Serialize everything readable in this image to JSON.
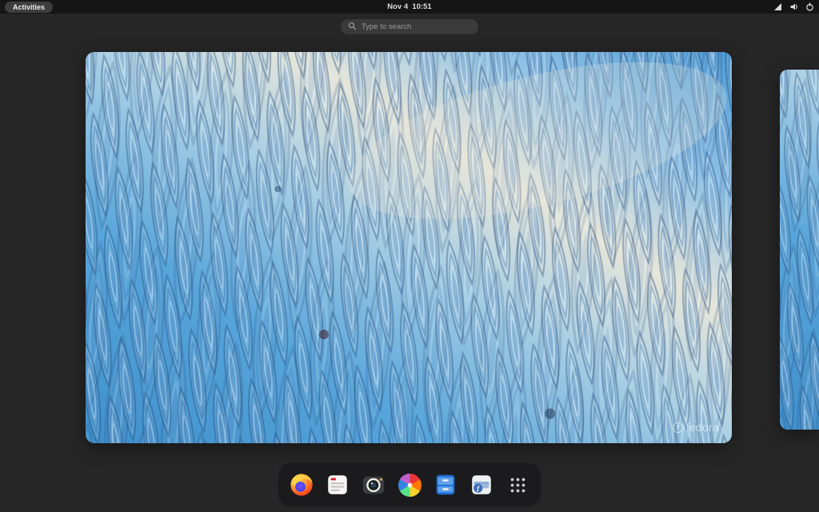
{
  "top_bar": {
    "activities_label": "Activities",
    "clock": "Nov 4  10:51",
    "status_icons": [
      "input-source-icon",
      "volume-icon",
      "power-icon"
    ]
  },
  "search": {
    "placeholder": "Type to search"
  },
  "workspaces": {
    "current": "workspace-preview-current",
    "next_partial": "workspace-preview-next"
  },
  "wallpaper": {
    "watermark": "fedora",
    "logo_glyph": "f",
    "dominant_colors": [
      "#3f8fcb",
      "#57a5da",
      "#a9cfe4",
      "#e6e6da"
    ]
  },
  "dash": {
    "apps": [
      "firefox",
      "calendar",
      "camera",
      "software",
      "files",
      "installer"
    ],
    "installer_glyph": "f",
    "show_apps": "show-applications-grid"
  },
  "colors": {
    "background": "#262626",
    "top_bar": "#151515",
    "search_bg": "#3a3a3a",
    "dash_bg": "#1b1b1d"
  }
}
